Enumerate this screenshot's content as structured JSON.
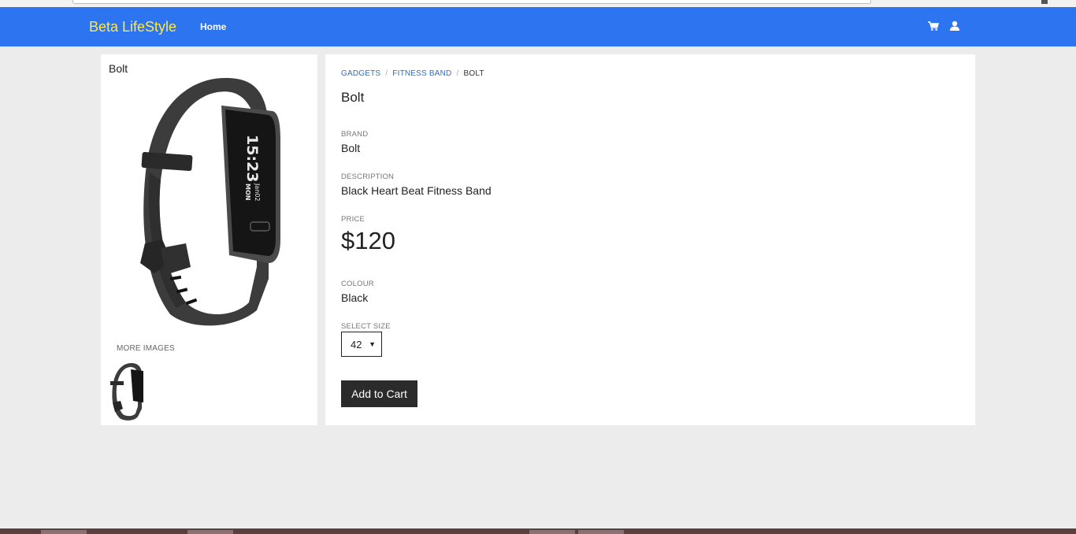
{
  "navbar": {
    "brand": "Beta LifeStyle",
    "home_label": "Home",
    "cart_icon": "cart-icon",
    "user_icon": "user-icon",
    "bg_color": "#2d74f0",
    "brand_color": "#ffe94a"
  },
  "left_panel": {
    "title": "Bolt",
    "more_images_label": "MORE IMAGES"
  },
  "product": {
    "breadcrumb": [
      "GADGETS",
      "FITNESS BAND",
      "BOLT"
    ],
    "title": "Bolt",
    "brand_label": "BRAND",
    "brand_value": "Bolt",
    "description_label": "DESCRIPTION",
    "description_value": "Black Heart Beat Fitness Band",
    "price_label": "PRICE",
    "price_value": "$120",
    "colour_label": "COLOUR",
    "colour_value": "Black",
    "size_label": "SELECT SIZE",
    "size_value": "42",
    "add_to_cart_label": "Add to Cart"
  },
  "band_display": {
    "time": "15:23",
    "date": "Jan02",
    "day": "MON"
  }
}
